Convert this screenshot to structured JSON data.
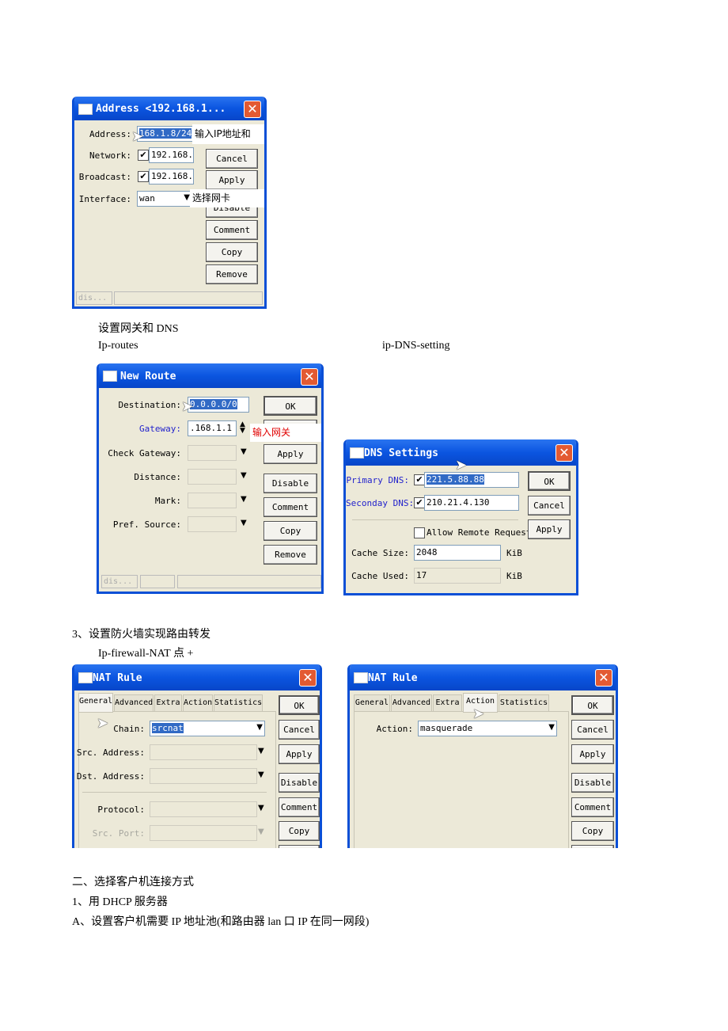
{
  "address_dialog": {
    "title": "Address <192.168.1...",
    "labels": {
      "address": "Address:",
      "network": "Network:",
      "broadcast": "Broadcast:",
      "interface": "Interface:"
    },
    "address_value": "168.1.8/24",
    "network_value": "192.168.",
    "broadcast_value": "192.168.",
    "interface_value": "wan",
    "buttons": [
      "Cancel",
      "Apply",
      "Disable",
      "Comment",
      "Copy",
      "Remove"
    ],
    "annotation_address": "输入IP地址和",
    "annotation_interface": "选择网卡",
    "status": "dis..."
  },
  "text": {
    "gateway_dns": "设置网关和 DNS",
    "ip_routes": "Ip-routes",
    "ip_dns": "ip-DNS-setting",
    "section3": "3、设置防火墙实现路由转发",
    "nat_path": "Ip-firewall-NAT 点   +",
    "section_two": "二、选择客户机连接方式",
    "dhcp": "1、用 DHCP 服务器",
    "pool": "A、设置客户机需要 IP 地址池(和路由器 lan 口 IP 在同一网段)"
  },
  "route_dialog": {
    "title": "New Route",
    "labels": {
      "destination": "Destination:",
      "gateway": "Gateway:",
      "check_gateway": "Check Gateway:",
      "distance": "Distance:",
      "mark": "Mark:",
      "pref_source": "Pref. Source:"
    },
    "destination_value": "0.0.0.0/0",
    "gateway_value": ".168.1.1",
    "buttons": [
      "OK",
      "Apply",
      "Disable",
      "Comment",
      "Copy",
      "Remove"
    ],
    "annotation_gateway": "输入网关",
    "status": "dis..."
  },
  "dns_dialog": {
    "title": "DNS Settings",
    "labels": {
      "primary": "Primary DNS:",
      "secondary": "Seconday DNS:",
      "allow_remote": "Allow Remote Requests",
      "cache_size": "Cache Size:",
      "cache_used": "Cache Used:",
      "unit": "KiB"
    },
    "primary_value": "221.5.88.88",
    "secondary_value": "210.21.4.130",
    "cache_size_value": "2048",
    "cache_used_value": "17",
    "buttons": [
      "OK",
      "Cancel",
      "Apply"
    ]
  },
  "nat_general": {
    "title": "NAT Rule",
    "tabs": [
      "General",
      "Advanced",
      "Extra",
      "Action",
      "Statistics"
    ],
    "labels": {
      "chain": "Chain:",
      "src_address": "Src. Address:",
      "dst_address": "Dst. Address:",
      "protocol": "Protocol:",
      "src_port": "Src. Port:"
    },
    "chain_value": "srcnat",
    "buttons": [
      "OK",
      "Cancel",
      "Apply",
      "Disable",
      "Comment",
      "Copy"
    ]
  },
  "nat_action": {
    "title": "NAT Rule",
    "tabs": [
      "General",
      "Advanced",
      "Extra",
      "Action",
      "Statistics"
    ],
    "labels": {
      "action": "Action:"
    },
    "action_value": "masquerade",
    "buttons": [
      "OK",
      "Cancel",
      "Apply",
      "Disable",
      "Comment",
      "Copy"
    ]
  },
  "colors": {
    "titlebar": "#0b55e0",
    "dialog_bg": "#ece9d8",
    "selection": "#316ac5",
    "annotation_red": "#e00000"
  }
}
